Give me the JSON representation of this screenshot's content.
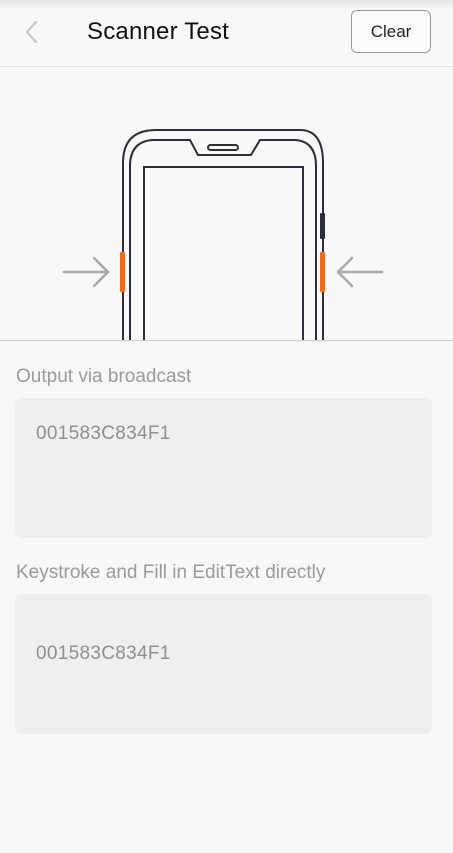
{
  "header": {
    "title": "Scanner Test",
    "clear_label": "Clear"
  },
  "icons": {
    "back": "chevron-left-icon",
    "left_arrow": "arrow-right-icon",
    "right_arrow": "arrow-left-icon",
    "device": "scanner-device-icon"
  },
  "colors": {
    "accent": "#f06a1e",
    "text_muted": "#9a9a9a",
    "box_bg": "#efefef"
  },
  "broadcast": {
    "label": "Output via broadcast",
    "value": "001583C834F1"
  },
  "keystroke": {
    "label": "Keystroke and Fill in EditText directly",
    "value": "001583C834F1"
  }
}
